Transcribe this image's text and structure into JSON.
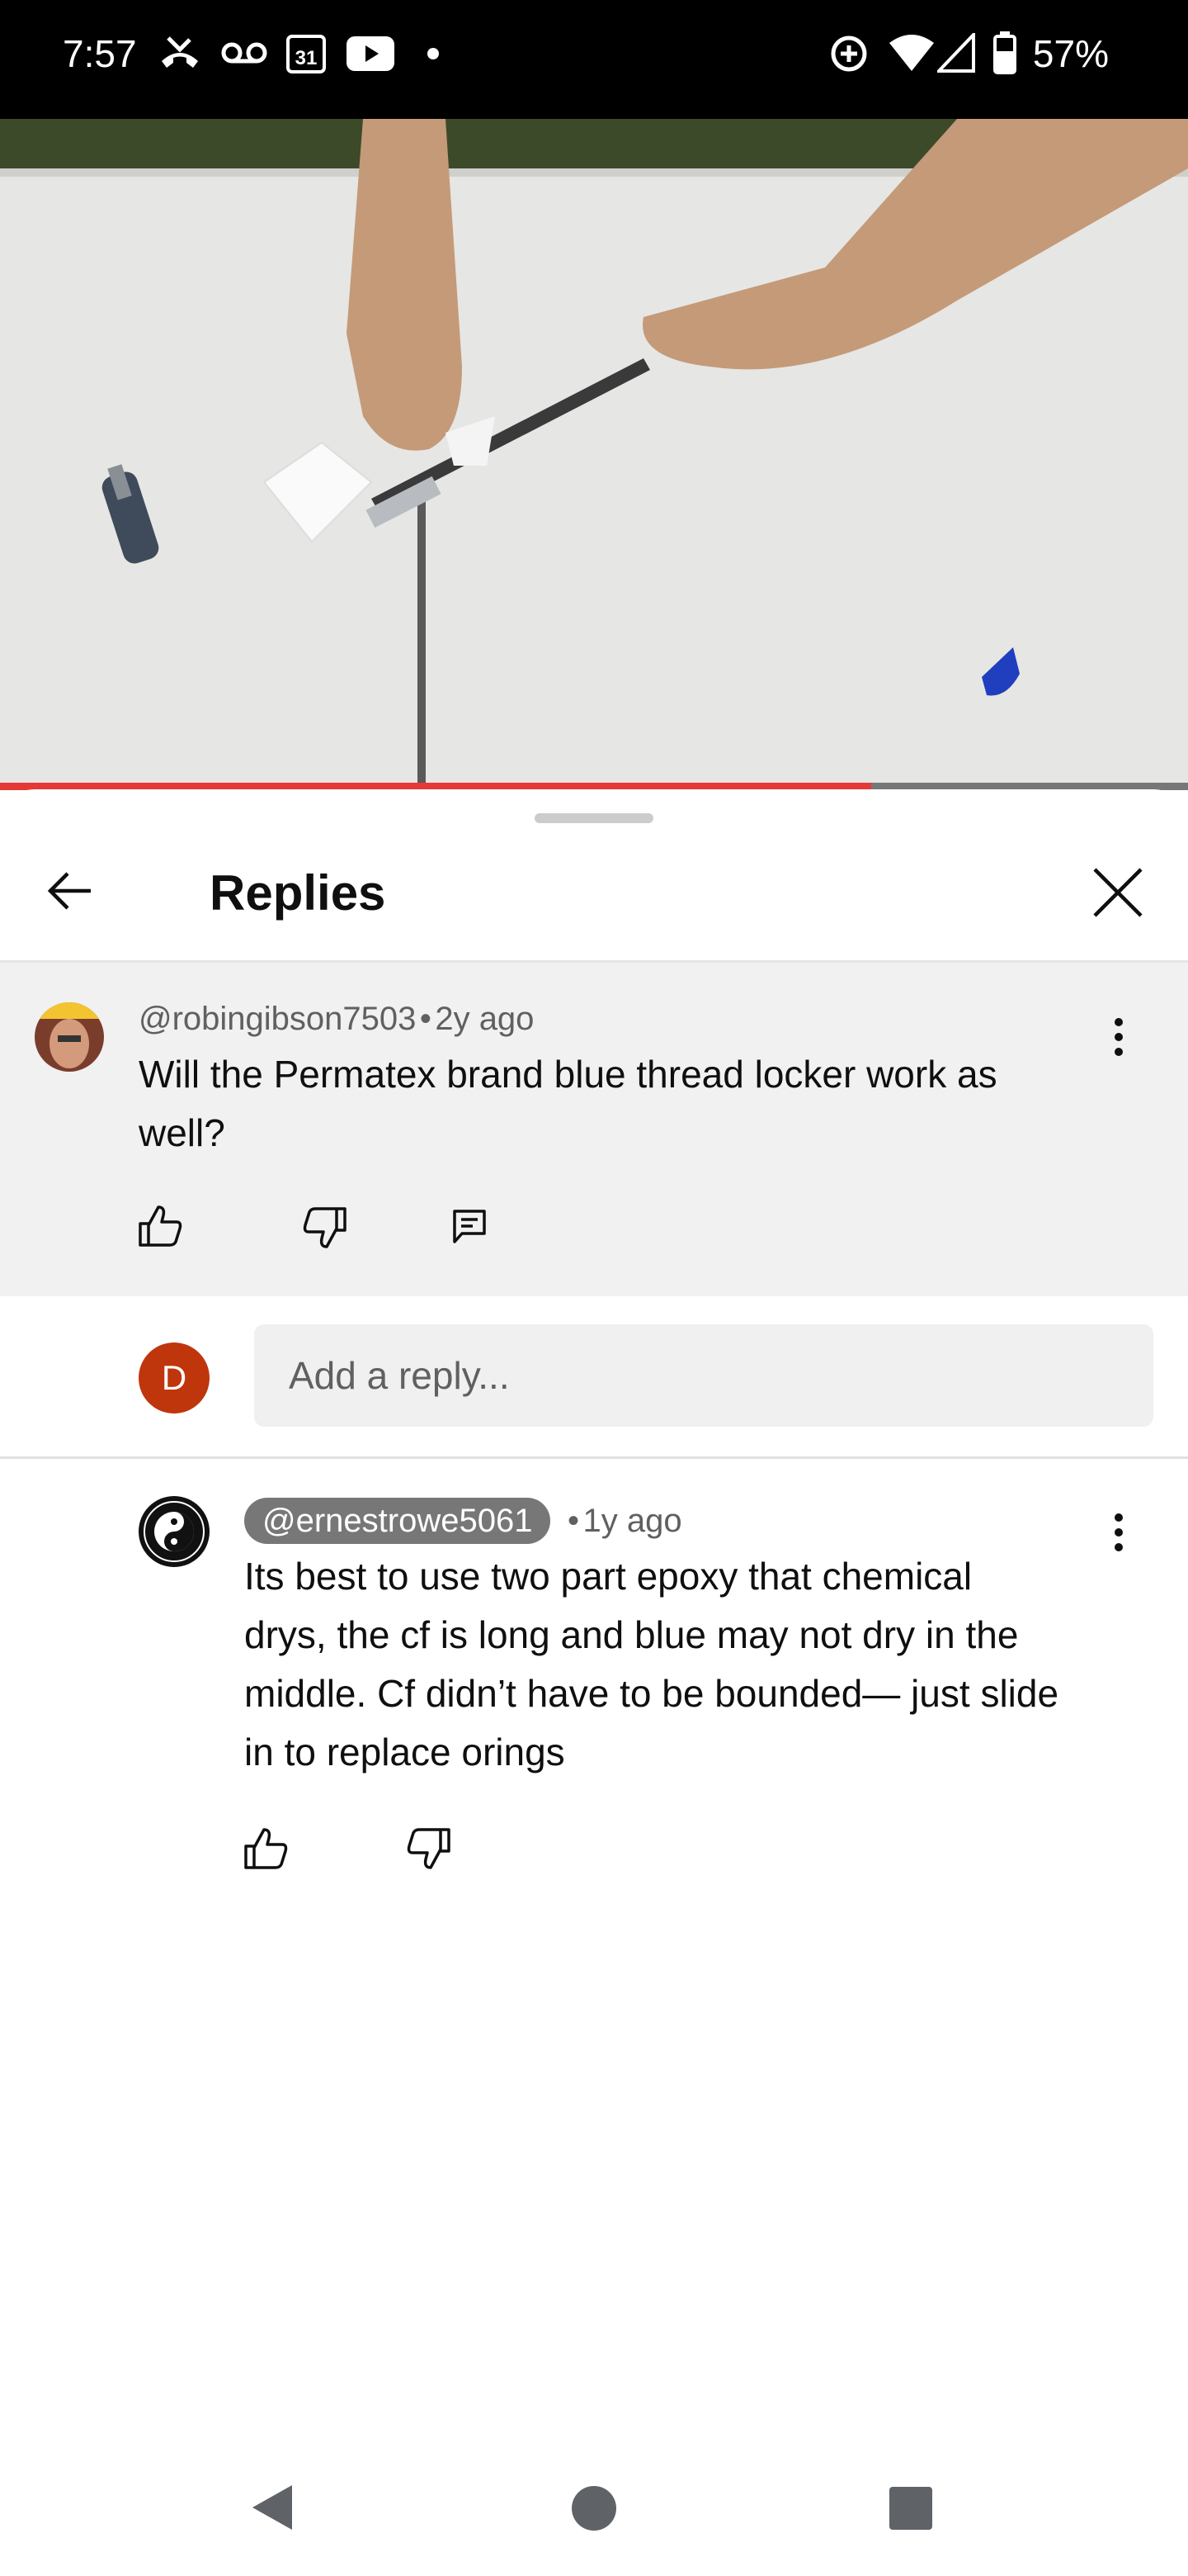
{
  "status_bar": {
    "time": "7:57",
    "battery": "57%",
    "icons": [
      "missed-call-icon",
      "voicemail-icon",
      "calendar-icon",
      "youtube-icon",
      "dot-icon",
      "data-saver-icon",
      "wifi-icon",
      "signal-icon",
      "battery-icon"
    ],
    "calendar_day": "31"
  },
  "video": {
    "progress": 0.733
  },
  "sheet": {
    "title": "Replies"
  },
  "parent_comment": {
    "author": "@robingibson7503",
    "time": "2y ago",
    "text_line1": "Will the Permatex brand blue thread locker work as",
    "text_line2": "well?"
  },
  "reply_box": {
    "avatar_letter": "D",
    "placeholder": "Add a reply..."
  },
  "reply": {
    "author": "@ernestrowe5061",
    "time": "1y ago",
    "lines": [
      "Its best to use two part epoxy that chemical",
      "drys, the cf is long and blue may not dry in the",
      "middle. Cf didn’t have to be bounded— just slide",
      "in to replace orings"
    ]
  },
  "separator": "•",
  "colors": {
    "progress": "#e53935",
    "avatar_d": "#bf360c",
    "parent_bg": "#f1f1f1"
  }
}
